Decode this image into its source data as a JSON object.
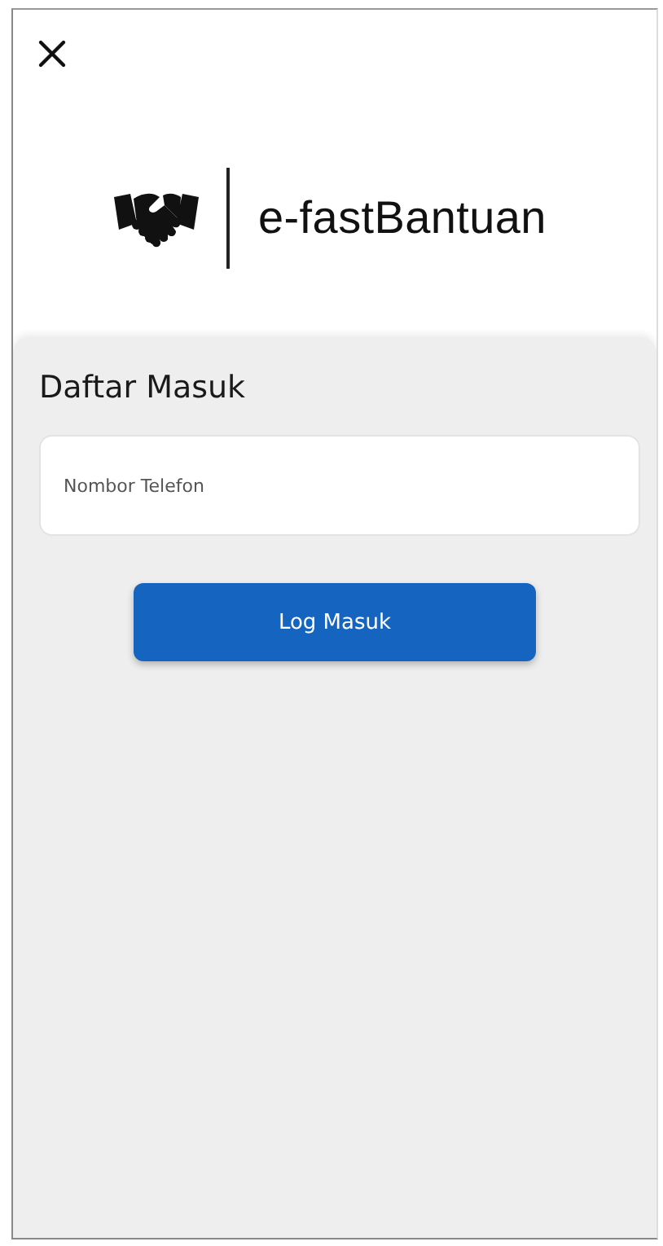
{
  "header": {
    "app_name": "e-fastBantuan"
  },
  "login": {
    "title": "Daftar Masuk",
    "phone_field": {
      "placeholder": "Nombor Telefon"
    },
    "button": {
      "label": "Log Masuk"
    }
  }
}
